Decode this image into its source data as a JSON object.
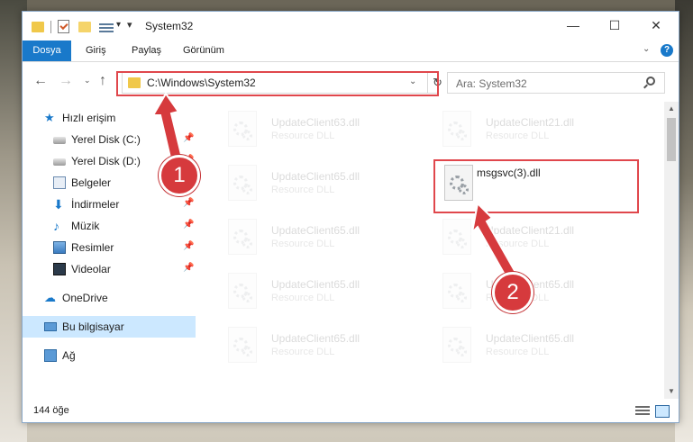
{
  "window": {
    "title": "System32",
    "controls": {
      "minimize": "—",
      "maximize": "☐",
      "close": "✕"
    }
  },
  "ribbon": {
    "tabs": [
      "Dosya",
      "Giriş",
      "Paylaş",
      "Görünüm"
    ],
    "expand": "⌄",
    "help": "?"
  },
  "navigation": {
    "back": "←",
    "forward": "→",
    "recent": "⌄",
    "up": "↑",
    "address": "C:\\Windows\\System32",
    "address_dropdown": "⌄",
    "refresh": "↻",
    "search_placeholder": "Ara: System32"
  },
  "sidebar": {
    "items": [
      {
        "label": "Hızlı erişim",
        "icon": "star-icon",
        "glyph": "★"
      },
      {
        "label": "Yerel Disk (C:)",
        "icon": "drive-icon",
        "pinned": true
      },
      {
        "label": "Yerel Disk (D:)",
        "icon": "drive-icon",
        "pinned": true
      },
      {
        "label": "Belgeler",
        "icon": "documents-icon",
        "pinned": true
      },
      {
        "label": "İndirmeler",
        "icon": "download-icon",
        "glyph": "⬇",
        "pinned": true
      },
      {
        "label": "Müzik",
        "icon": "music-icon",
        "glyph": "♪",
        "pinned": true
      },
      {
        "label": "Resimler",
        "icon": "pictures-icon",
        "pinned": true
      },
      {
        "label": "Videolar",
        "icon": "videos-icon",
        "pinned": true
      },
      {
        "label": "OneDrive",
        "icon": "cloud-icon",
        "glyph": "☁"
      },
      {
        "label": "Bu bilgisayar",
        "icon": "computer-icon",
        "selected": true
      },
      {
        "label": "Ağ",
        "icon": "network-icon"
      }
    ],
    "pin_glyph": "📌"
  },
  "files": [
    {
      "name": "UpdateClient63.dll",
      "desc": "Resource DLL",
      "faded": true
    },
    {
      "name": "UpdateClient21.dll",
      "desc": "Resource DLL",
      "faded": true
    },
    {
      "name": "UpdateClient65.dll",
      "desc": "Resource DLL",
      "faded": true
    },
    {
      "name": "msgsvc(3).dll",
      "desc": "",
      "faded": false
    },
    {
      "name": "UpdateClient65.dll",
      "desc": "Resource DLL",
      "faded": true
    },
    {
      "name": "UpdateClient21.dll",
      "desc": "Resource DLL",
      "faded": true
    },
    {
      "name": "UpdateClient65.dll",
      "desc": "Resource DLL",
      "faded": true
    },
    {
      "name": "UpdateClient65.dll",
      "desc": "Resource DLL",
      "faded": true
    },
    {
      "name": "UpdateClient65.dll",
      "desc": "Resource DLL",
      "faded": true
    },
    {
      "name": "UpdateClient65.dll",
      "desc": "Resource DLL",
      "faded": true
    }
  ],
  "scrollbar": {
    "up": "▲",
    "down": "▼"
  },
  "status": {
    "count": "144 öğe"
  },
  "annotations": {
    "badge1": "1",
    "badge2": "2",
    "color": "#d63a3d"
  }
}
